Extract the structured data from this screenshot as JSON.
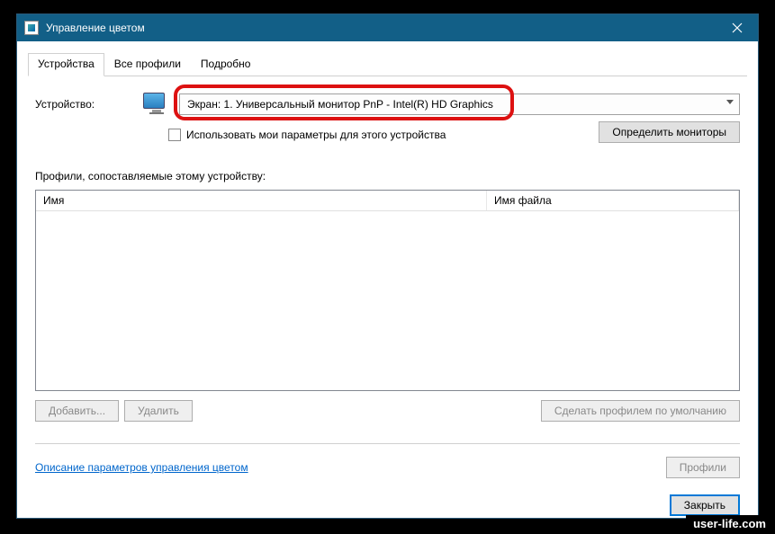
{
  "window": {
    "title": "Управление цветом"
  },
  "tabs": {
    "devices": "Устройства",
    "allProfiles": "Все профили",
    "advanced": "Подробно"
  },
  "deviceRow": {
    "label": "Устройство:",
    "selected": "Экран: 1. Универсальный монитор PnP - Intel(R) HD Graphics"
  },
  "useMySettings": "Использовать мои параметры для этого устройства",
  "identifyMonitors": "Определить мониторы",
  "profilesLabel": "Профили, сопоставляемые этому устройству:",
  "columns": {
    "name": "Имя",
    "file": "Имя файла"
  },
  "buttons": {
    "add": "Добавить...",
    "remove": "Удалить",
    "setDefault": "Сделать профилем по умолчанию",
    "profiles": "Профили",
    "close": "Закрыть"
  },
  "link": "Описание параметров управления цветом",
  "watermark": "user-life.com"
}
